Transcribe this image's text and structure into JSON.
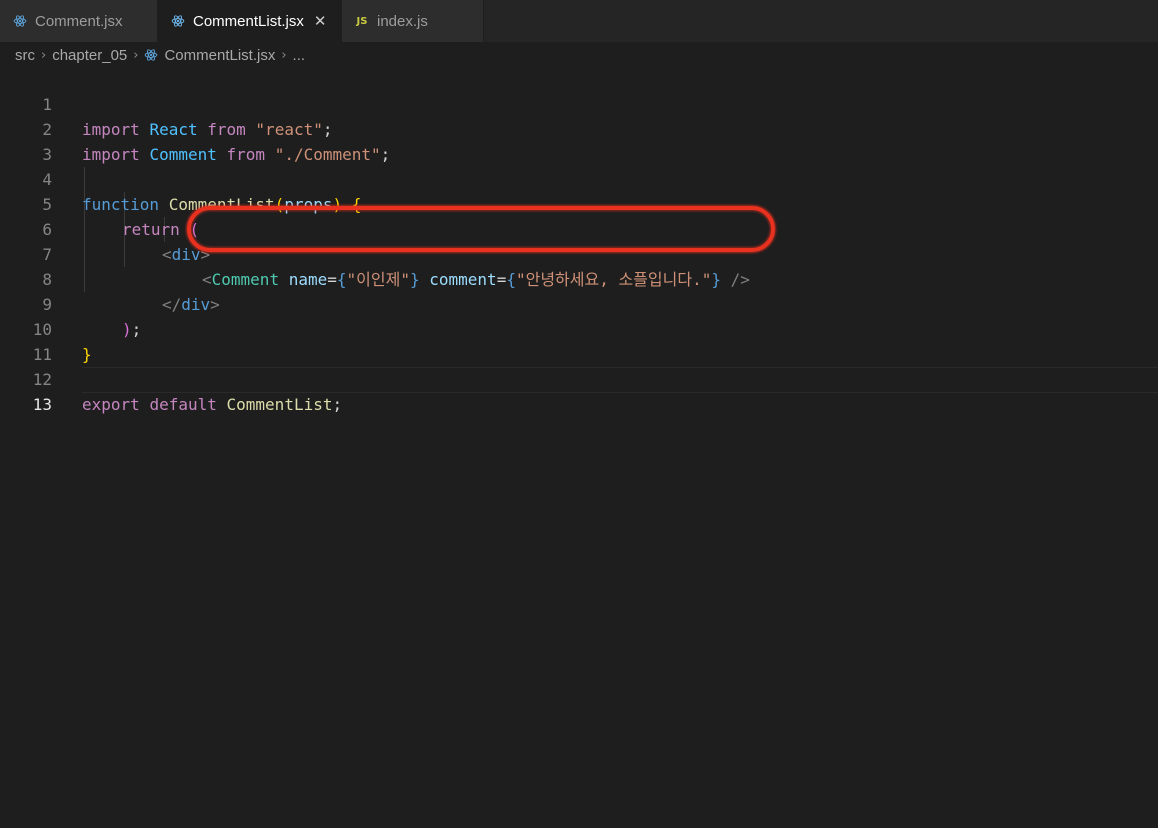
{
  "tabs": [
    {
      "label": "Comment.jsx",
      "icon": "react-icon",
      "active": false
    },
    {
      "label": "CommentList.jsx",
      "icon": "react-icon",
      "active": true,
      "close": "✕"
    },
    {
      "label": "index.js",
      "icon": "js-icon",
      "badge": "JS",
      "active": false
    }
  ],
  "breadcrumb": {
    "items": [
      "src",
      "chapter_05",
      "CommentList.jsx",
      "..."
    ],
    "separator": "›"
  },
  "editor": {
    "current_line": 13,
    "lines": [
      {
        "n": "1",
        "tokens": [
          [
            "kw",
            "import"
          ],
          [
            "",
            ""
          ],
          [
            "var",
            "React"
          ],
          [
            "kw",
            "from"
          ],
          [
            "str",
            "\"react\""
          ],
          [
            "brace",
            ";"
          ]
        ]
      },
      {
        "n": "2"
      },
      {
        "n": "3"
      },
      {
        "n": "4"
      },
      {
        "n": "5"
      },
      {
        "n": "6"
      },
      {
        "n": "7"
      },
      {
        "n": "8"
      },
      {
        "n": "9"
      },
      {
        "n": "10"
      },
      {
        "n": "11"
      },
      {
        "n": "12"
      },
      {
        "n": "13"
      }
    ],
    "code": {
      "l1": {
        "import": "import",
        "name": "React",
        "from": "from",
        "src": "\"react\"",
        "semi": ";"
      },
      "l2": {
        "import": "import",
        "name": "Comment",
        "from": "from",
        "src": "\"./Comment\"",
        "semi": ";"
      },
      "l4": {
        "function": "function",
        "name": "CommentList",
        "open": "(",
        "param": "props",
        "close": ")",
        "brace": "{"
      },
      "l5": {
        "return": "return",
        "paren": "("
      },
      "l6": {
        "open": "<",
        "tag": "div",
        "close": ">"
      },
      "l7": {
        "open": "<",
        "tag": "Comment",
        "attr1": "name",
        "eq1": "=",
        "b1o": "{",
        "v1": "\"이인제\"",
        "b1c": "}",
        "attr2": "comment",
        "eq2": "=",
        "b2o": "{",
        "v2": "\"안녕하세요, 소플입니다.\"",
        "b2c": "}",
        "selfclose": "/>"
      },
      "l8": {
        "open": "</",
        "tag": "div",
        "close": ">"
      },
      "l9": {
        "paren": ")",
        "semi": ";"
      },
      "l10": {
        "brace": "}"
      },
      "l12": {
        "export": "export",
        "default": "default",
        "name": "CommentList",
        "semi": ";"
      }
    }
  },
  "annotation": {
    "color": "#e8311f",
    "shape": "hand-drawn oval around line 7"
  }
}
